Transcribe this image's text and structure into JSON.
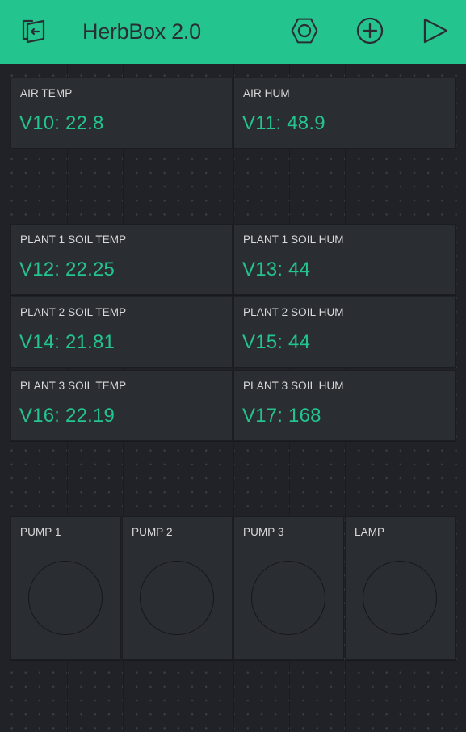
{
  "header": {
    "title": "HerbBox 2.0",
    "icons": [
      "exit-icon",
      "settings-hexagon-icon",
      "add-widget-icon",
      "play-icon"
    ],
    "background": "#23c48e"
  },
  "theme": {
    "accent": "#23c48e",
    "widget_bg": "#2a2d31",
    "canvas_bg": "#212227",
    "label_color": "#d9dadb"
  },
  "displays": [
    {
      "label": "AIR TEMP",
      "value": "V10: 22.8"
    },
    {
      "label": "AIR HUM",
      "value": "V11: 48.9"
    },
    {
      "label": "PLANT 1 SOIL TEMP",
      "value": "V12: 22.25"
    },
    {
      "label": "PLANT 1 SOIL HUM",
      "value": "V13: 44"
    },
    {
      "label": "PLANT 2 SOIL TEMP",
      "value": "V14: 21.81"
    },
    {
      "label": "PLANT 2 SOIL HUM",
      "value": "V15: 44"
    },
    {
      "label": "PLANT 3 SOIL TEMP",
      "value": "V16: 22.19"
    },
    {
      "label": "PLANT 3 SOIL HUM",
      "value": "V17: 168"
    }
  ],
  "buttons": [
    {
      "label": "PUMP 1"
    },
    {
      "label": "PUMP 2"
    },
    {
      "label": "PUMP 3"
    },
    {
      "label": "LAMP"
    }
  ]
}
